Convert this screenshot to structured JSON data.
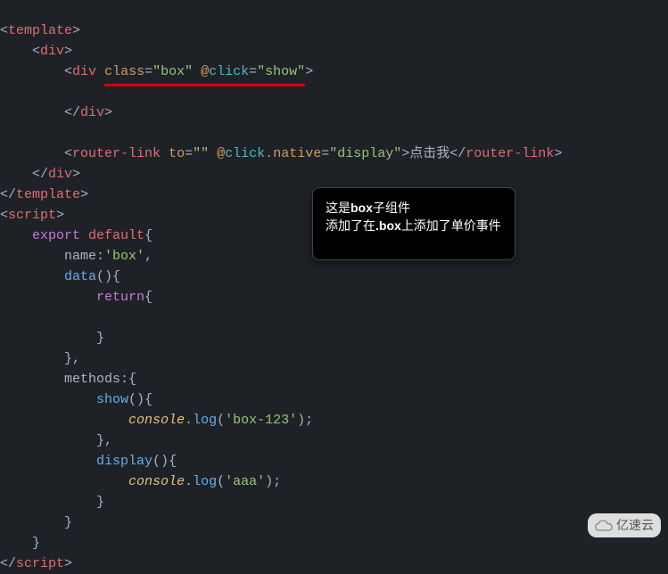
{
  "code": {
    "l1": {
      "open": "<",
      "tag": "template",
      "close": ">"
    },
    "l2": {
      "indent": "    ",
      "open": "<",
      "tag": "div",
      "close": ">"
    },
    "l3": {
      "indent": "        ",
      "open": "<",
      "tag": "div",
      "sp": " ",
      "attr1": "class",
      "eq": "=",
      "val1": "\"box\"",
      "sp2": " ",
      "at": "@",
      "evt": "click",
      "eq2": "=",
      "val2": "\"show\"",
      "close": ">"
    },
    "l4": {
      "text": ""
    },
    "l5": {
      "indent": "        ",
      "open": "</",
      "tag": "div",
      "close": ">"
    },
    "l6": {
      "text": ""
    },
    "l7": {
      "indent": "        ",
      "open": "<",
      "tag": "router-link",
      "sp": " ",
      "attr1": "to",
      "eq": "=",
      "val1": "\"\"",
      "sp2": " ",
      "at": "@",
      "evt": "click",
      "dot": ".",
      "mod": "native",
      "eq2": "=",
      "val2": "\"display\"",
      "close": ">",
      "text": "点击我",
      "open2": "</",
      "tag2": "router-link",
      "close2": ">"
    },
    "l8": {
      "indent": "    ",
      "open": "</",
      "tag": "div",
      "close": ">"
    },
    "l9": {
      "open": "</",
      "tag": "template",
      "close": ">"
    },
    "l10": {
      "open": "<",
      "tag": "script",
      "close": ">"
    },
    "l11": {
      "indent": "    ",
      "export": "export",
      "sp": " ",
      "default": "default",
      "brace": "{"
    },
    "l12": {
      "indent": "        ",
      "prop": "name",
      "colon": ":",
      "val": "'box'",
      "comma": ","
    },
    "l13": {
      "indent": "        ",
      "fn": "data",
      "paren": "()",
      "brace": "{"
    },
    "l14": {
      "indent": "            ",
      "ret": "return",
      "brace": "{"
    },
    "l15": {
      "text": ""
    },
    "l16": {
      "indent": "            ",
      "brace": "}"
    },
    "l17": {
      "indent": "        ",
      "brace": "}",
      "comma": ","
    },
    "l18": {
      "indent": "        ",
      "prop": "methods",
      "colon": ":",
      "brace": "{"
    },
    "l19": {
      "indent": "            ",
      "fn": "show",
      "paren": "()",
      "brace": "{"
    },
    "l20": {
      "indent": "                ",
      "obj": "console",
      "dot": ".",
      "method": "log",
      "paren": "(",
      "str": "'box-123'",
      "paren2": ")",
      "semi": ";"
    },
    "l21": {
      "indent": "            ",
      "brace": "}",
      "comma": ","
    },
    "l22": {
      "indent": "            ",
      "fn": "display",
      "paren": "()",
      "brace": "{"
    },
    "l23": {
      "indent": "                ",
      "obj": "console",
      "dot": ".",
      "method": "log",
      "paren": "(",
      "str": "'aaa'",
      "paren2": ")",
      "semi": ";"
    },
    "l24": {
      "indent": "            ",
      "brace": "}"
    },
    "l25": {
      "indent": "        ",
      "brace": "}"
    },
    "l26": {
      "indent": "    ",
      "brace": "}"
    },
    "l27": {
      "open": "</",
      "tag": "script",
      "close": ">"
    }
  },
  "tooltip": {
    "line1a": "这是",
    "line1b": "box",
    "line1c": "子组件",
    "line2a": "添加了在",
    "line2b": ".box",
    "line2c": "上添加了单价事件"
  },
  "watermark": {
    "text": "亿速云"
  }
}
